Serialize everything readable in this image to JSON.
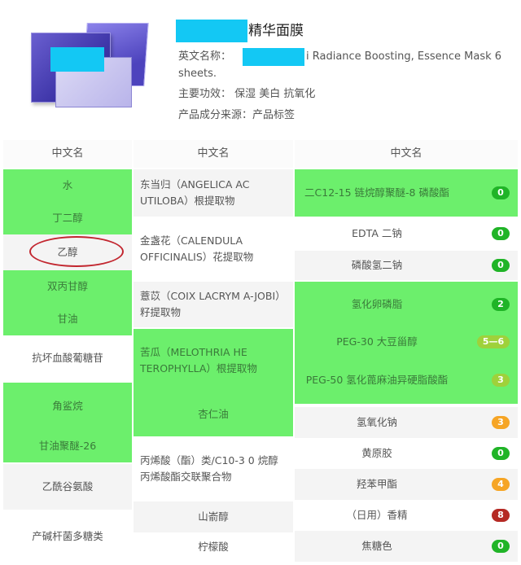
{
  "header": {
    "title_suffix": "精华面膜",
    "english_name_label": "英文名称：",
    "english_name_value": "i Radiance Boosting, Essence Mask 6",
    "english_name_value_cont": "sheets.",
    "efficacy_label": "主要功效：",
    "efficacy_value": "保湿 美白 抗氧化",
    "source_label": "产品成分来源：",
    "source_value": "产品标签"
  },
  "table": {
    "col1_header": "中文名",
    "col2_header": "中文名",
    "col3_header": "中文名",
    "col1": [
      "水",
      "丁二醇",
      "乙醇",
      "双丙甘醇",
      "甘油",
      "抗坏血酸葡糖苷",
      "角鲨烷",
      "甘油聚醚-26",
      "乙酰谷氨酸",
      "产碱杆菌多糖类"
    ],
    "col2": [
      "东当归（ANGELICA AC UTILOBA）根提取物",
      "金盏花（CALENDULA OFFICINALIS）花提取物",
      "薏苡（COIX LACRYM A-JOBI）籽提取物",
      "苦瓜（MELOTHRIA HE TEROPHYLLA）根提取物",
      "杏仁油",
      "丙烯酸（酯）类/C10-3 0 烷醇丙烯酸酯交联聚合物",
      "山嵛醇",
      "柠檬酸"
    ],
    "col3": [
      {
        "name": "二C12-15 链烷醇聚醚-8 磷酸酯",
        "score": "0",
        "level": "green"
      },
      {
        "name": "EDTA 二钠",
        "score": "0",
        "level": "green"
      },
      {
        "name": "磷酸氢二钠",
        "score": "0",
        "level": "green"
      },
      {
        "name": "氢化卵磷脂",
        "score": "2",
        "level": "green"
      },
      {
        "name": "PEG-30 大豆甾醇",
        "score": "5—6",
        "level": "ygreen"
      },
      {
        "name": "PEG-50 氢化蓖麻油异硬脂酸酯",
        "score": "3",
        "level": "ygreen"
      },
      {
        "name": "氢氧化钠",
        "score": "3",
        "level": "orange"
      },
      {
        "name": "黄原胶",
        "score": "0",
        "level": "green"
      },
      {
        "name": "羟苯甲酯",
        "score": "4",
        "level": "orange"
      },
      {
        "name": "（日用）香精",
        "score": "8",
        "level": "red"
      },
      {
        "name": "焦糖色",
        "score": "0",
        "level": "green"
      }
    ]
  },
  "colors": {
    "highlight": "#6cef6c",
    "redact": "#13c8f4",
    "circle": "#c2262f"
  }
}
